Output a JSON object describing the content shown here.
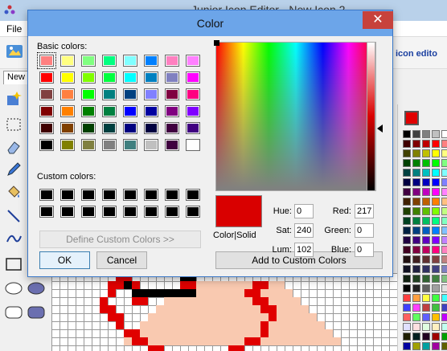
{
  "app": {
    "title": "Junior Icon Editor - New Icon 2",
    "menu": {
      "file": "File"
    },
    "toolbar": {
      "editor_label": "icon edito"
    },
    "tab": "New"
  },
  "dialog": {
    "title": "Color",
    "close_symbol": "✕",
    "basic_colors_label": "Basic colors:",
    "custom_colors_label": "Custom colors:",
    "define_button": "Define Custom Colors >>",
    "ok_button": "OK",
    "cancel_button": "Cancel",
    "add_button": "Add to Custom Colors",
    "preview_label": "Color|Solid",
    "fields": {
      "hue_label": "Hue:",
      "hue": "0",
      "sat_label": "Sat:",
      "sat": "240",
      "lum_label": "Lum:",
      "lum": "102",
      "red_label": "Red:",
      "red": "217",
      "green_label": "Green:",
      "green": "0",
      "blue_label": "Blue:",
      "blue": "0"
    },
    "selected_color": "#d90000",
    "lum_level_fraction": 0.42,
    "basic_colors": [
      "#ff8080",
      "#ffff80",
      "#80ff80",
      "#00ff80",
      "#80ffff",
      "#0080ff",
      "#ff80c0",
      "#ff80ff",
      "#ff0000",
      "#ffff00",
      "#80ff00",
      "#00ff40",
      "#00ffff",
      "#0080c0",
      "#8080c0",
      "#ff00ff",
      "#804040",
      "#ff8040",
      "#00ff00",
      "#008080",
      "#004080",
      "#8080ff",
      "#800040",
      "#ff0080",
      "#800000",
      "#ff8000",
      "#008000",
      "#008040",
      "#0000ff",
      "#0000a0",
      "#800080",
      "#8000ff",
      "#400000",
      "#804000",
      "#004000",
      "#004040",
      "#000080",
      "#000040",
      "#400040",
      "#400080",
      "#000000",
      "#808000",
      "#808040",
      "#808080",
      "#408080",
      "#c0c0c0",
      "#400040",
      "#ffffff"
    ],
    "custom_colors": [
      "#000000",
      "#000000",
      "#000000",
      "#000000",
      "#000000",
      "#000000",
      "#000000",
      "#000000",
      "#000000",
      "#000000",
      "#000000",
      "#000000",
      "#000000",
      "#000000",
      "#000000",
      "#000000"
    ]
  },
  "palette": {
    "current": "#e00000",
    "colors": [
      "#000000",
      "#404040",
      "#808080",
      "#c0c0c0",
      "#ffffff",
      "#400000",
      "#800000",
      "#c00000",
      "#ff0000",
      "#ff8080",
      "#404000",
      "#808000",
      "#c0c000",
      "#ffff00",
      "#ffff80",
      "#004000",
      "#008000",
      "#00c000",
      "#00ff00",
      "#80ff80",
      "#004040",
      "#008080",
      "#00c0c0",
      "#00ffff",
      "#80ffff",
      "#000040",
      "#000080",
      "#0000c0",
      "#0000ff",
      "#8080ff",
      "#400040",
      "#800080",
      "#c000c0",
      "#ff00ff",
      "#ff80ff",
      "#402000",
      "#804000",
      "#c06000",
      "#ff8000",
      "#ffc080",
      "#204000",
      "#408000",
      "#60c000",
      "#80ff00",
      "#c0ff80",
      "#004020",
      "#008040",
      "#00c060",
      "#00ff80",
      "#80ffc0",
      "#002040",
      "#004080",
      "#0060c0",
      "#0080ff",
      "#80c0ff",
      "#200040",
      "#400080",
      "#6000c0",
      "#8000ff",
      "#c080ff",
      "#400020",
      "#800040",
      "#c00060",
      "#ff0080",
      "#ff80c0",
      "#201010",
      "#402020",
      "#603030",
      "#804040",
      "#c08080",
      "#101020",
      "#202040",
      "#303060",
      "#404080",
      "#8080c0",
      "#102010",
      "#204020",
      "#306030",
      "#408040",
      "#80c080",
      "#000000",
      "#202020",
      "#606060",
      "#a0a0a0",
      "#e0e0e0",
      "#ff4040",
      "#ffa040",
      "#ffff40",
      "#40ff40",
      "#40ffff",
      "#4040ff",
      "#ff40ff",
      "#c04040",
      "#40c040",
      "#4040c0",
      "#ff6060",
      "#60ff60",
      "#6060ff",
      "#ffc000",
      "#c000ff",
      "#e0e0ff",
      "#ffe0e0",
      "#e0ffe0",
      "#fff0c0",
      "#c0fff0",
      "#202000",
      "#002020",
      "#200020",
      "#a00000",
      "#00a000",
      "#0000a0",
      "#a0a000",
      "#00a0a0",
      "#a000a0",
      "#606000",
      "#ff2020",
      "#20ff20",
      "#2020ff",
      "#ffd0d0",
      "#d0d0ff"
    ]
  },
  "canvas": {
    "colors": {
      "red": "#e00000",
      "black": "#000000",
      "skin": "#f9c9b0"
    }
  }
}
